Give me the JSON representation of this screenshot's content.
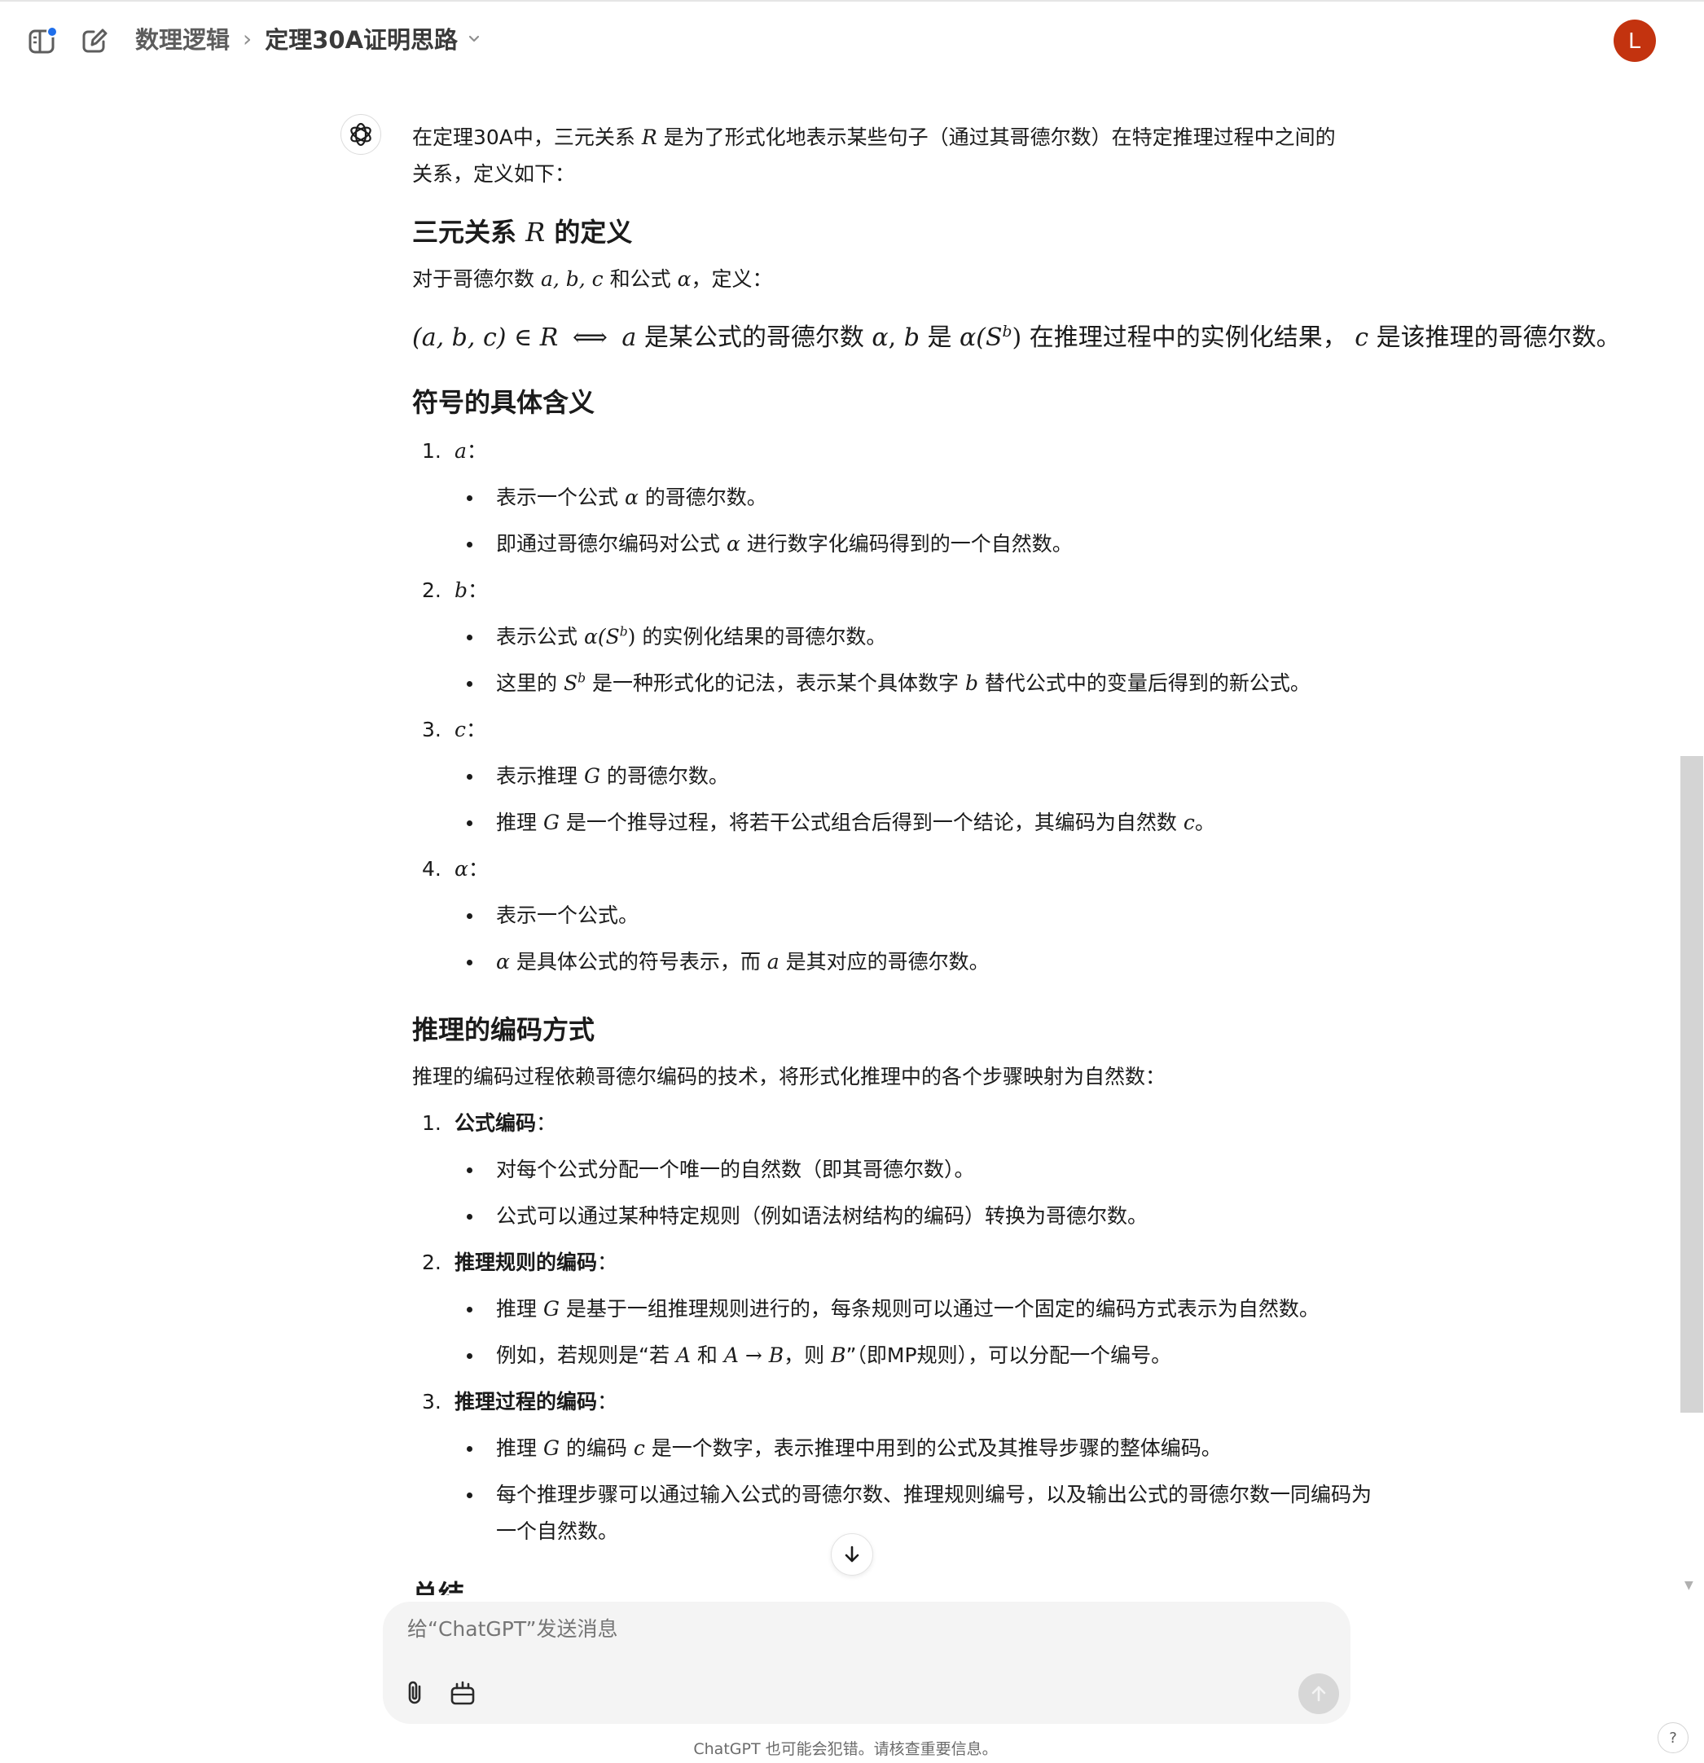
{
  "header": {
    "breadcrumb_project": "数理逻辑",
    "breadcrumb_sep": "›",
    "breadcrumb_title": "定理30A证明思路",
    "avatar_letter": "L",
    "icons": [
      "sidebar-toggle-icon",
      "new-chat-icon",
      "chevron-down-icon"
    ]
  },
  "message": {
    "intro_1": "在定理30A中，三元关系 ",
    "intro_R": "R",
    "intro_2": " 是为了形式化地表示某些句子（通过其哥德尔数）在特定推理过程中之间的关系，定义如下：",
    "h_def_1": "三元关系 ",
    "h_def_R": "R",
    "h_def_2": " 的定义",
    "def_lead_1": "对于哥德尔数 ",
    "def_lead_abc": "a, b, c",
    "def_lead_2": " 和公式 ",
    "def_lead_alpha": "α",
    "def_lead_3": "，定义：",
    "def_formula": {
      "lhs": "(a, b, c) ∈ R",
      "iff": "⟺",
      "a": "a",
      "t1": " 是某公式的哥德尔数 ",
      "alpha": "α",
      "comma": ", ",
      "b": "b",
      "t2": " 是 ",
      "alpha_S": "α(S",
      "sup_b": "b",
      "close": ")",
      "t3": " 在推理过程中的实例化结果， ",
      "c": "c",
      "t4": " 是该推理的哥德尔数。"
    },
    "h_symbols": "符号的具体含义",
    "symbols": [
      {
        "num": "1.",
        "var": "a",
        "colon": "："
      },
      {
        "num": "2.",
        "var": "b",
        "colon": "："
      },
      {
        "num": "3.",
        "var": "c",
        "colon": "："
      },
      {
        "num": "4.",
        "var": "α",
        "colon": "："
      }
    ],
    "s1_b1": [
      "表示一个公式 ",
      "α",
      " 的哥德尔数。"
    ],
    "s1_b2": [
      "即通过哥德尔编码对公式 ",
      "α",
      " 进行数字化编码得到的一个自然数。"
    ],
    "s2_b1": [
      "表示公式 ",
      "α(S",
      "b",
      ")",
      " 的实例化结果的哥德尔数。"
    ],
    "s2_b2": [
      "这里的 ",
      "S",
      "b",
      " 是一种形式化的记法，表示某个具体数字 ",
      "b",
      " 替代公式中的变量后得到的新公式。"
    ],
    "s3_b1": [
      "表示推理 ",
      "G",
      " 的哥德尔数。"
    ],
    "s3_b2": [
      "推理 ",
      "G",
      " 是一个推导过程，将若干公式组合后得到一个结论，其编码为自然数 ",
      "c",
      "。"
    ],
    "s4_b1": "表示一个公式。",
    "s4_b2": [
      "α",
      " 是具体公式的符号表示，而 ",
      "a",
      " 是其对应的哥德尔数。"
    ],
    "h_encoding": "推理的编码方式",
    "enc_lead": "推理的编码过程依赖哥德尔编码的技术，将形式化推理中的各个步骤映射为自然数：",
    "enc": [
      {
        "num": "1.",
        "title": "公式编码",
        "colon": "："
      },
      {
        "num": "2.",
        "title": "推理规则的编码",
        "colon": "："
      },
      {
        "num": "3.",
        "title": "推理过程的编码",
        "colon": "："
      }
    ],
    "e1_b1": "对每个公式分配一个唯一的自然数（即其哥德尔数）。",
    "e1_b2": "公式可以通过某种特定规则（例如语法树结构的编码）转换为哥德尔数。",
    "e2_b1": [
      "推理 ",
      "G",
      " 是基于一组推理规则进行的，每条规则可以通过一个固定的编码方式表示为自然数。"
    ],
    "e2_b2": [
      "例如，若规则是“若 ",
      "A",
      " 和 ",
      "A → B",
      "，则 ",
      "B",
      "”（即MP规则），可以分配一个编号。"
    ],
    "e3_b1": [
      "推理 ",
      "G",
      " 的编码 ",
      "c",
      " 是一个数字，表示推理中用到的公式及其推导步骤的整体编码。"
    ],
    "e3_b2": "每个推理步骤可以通过输入公式的哥德尔数、推理规则编号，以及输出公式的哥德尔数一同编码为一个自然数。",
    "h_summary": "总结"
  },
  "composer": {
    "placeholder": "给“ChatGPT”发送消息",
    "icons": [
      "attach-icon",
      "tools-icon",
      "send-icon"
    ]
  },
  "footer": {
    "note": "ChatGPT 也可能会犯错。请核查重要信息。",
    "help": "?"
  }
}
